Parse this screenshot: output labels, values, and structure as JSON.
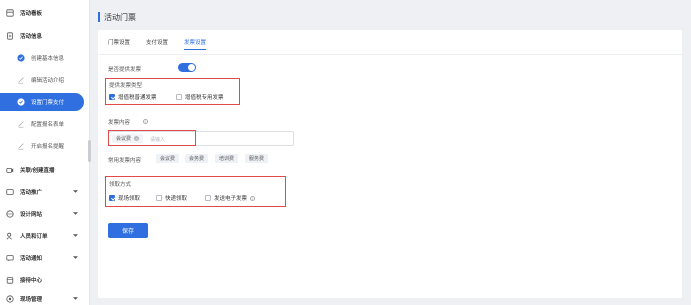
{
  "sidebar": {
    "items": [
      {
        "label": "活动看板",
        "icon": "dashboard-icon",
        "type": "main"
      },
      {
        "label": "活动信息",
        "icon": "document-icon",
        "type": "main"
      },
      {
        "label": "创建基本信息",
        "icon": "check-circle-icon",
        "type": "sub"
      },
      {
        "label": "编辑活动介绍",
        "icon": "edit-icon",
        "type": "sub"
      },
      {
        "label": "设置门票支付",
        "icon": "check-circle-icon",
        "type": "sub-active"
      },
      {
        "label": "配置报名表单",
        "icon": "edit-icon",
        "type": "sub"
      },
      {
        "label": "开启报名提醒",
        "icon": "edit-icon",
        "type": "sub"
      },
      {
        "label": "关联/创建直播",
        "icon": "video-icon",
        "type": "main"
      },
      {
        "label": "活动推广",
        "icon": "promote-icon",
        "type": "main",
        "caret": true
      },
      {
        "label": "设计网站",
        "icon": "globe-icon",
        "type": "main",
        "caret": true
      },
      {
        "label": "人员和订单",
        "icon": "users-icon",
        "type": "main",
        "caret": true
      },
      {
        "label": "活动通知",
        "icon": "message-icon",
        "type": "main",
        "caret": true
      },
      {
        "label": "接待中心",
        "icon": "reception-icon",
        "type": "main"
      },
      {
        "label": "现场管理",
        "icon": "onsite-icon",
        "type": "main",
        "caret": true
      }
    ]
  },
  "page": {
    "title": "活动门票"
  },
  "tabs": [
    "门票设置",
    "支付设置",
    "发票设置"
  ],
  "active_tab_index": 2,
  "invoice": {
    "provide_label": "是否提供发票",
    "provide_enabled": true,
    "type_label": "提供发票类型",
    "types": [
      {
        "label": "增值税普通发票",
        "checked": true
      },
      {
        "label": "增值税专用发票",
        "checked": false
      }
    ],
    "content_label": "发票内容",
    "content_chip": "会议费",
    "content_placeholder": "请输入",
    "common_label": "常用发票内容",
    "common_tags": [
      "会议费",
      "会务费",
      "培训费",
      "服务费"
    ],
    "method_label": "领取方式",
    "methods": [
      {
        "label": "现场领取",
        "checked": true
      },
      {
        "label": "快递领取",
        "checked": false
      },
      {
        "label": "发送电子发票",
        "checked": false,
        "info": true
      }
    ],
    "save_label": "保存"
  },
  "colors": {
    "accent": "#2f6fe0",
    "highlight_box": "#e24a4a"
  }
}
